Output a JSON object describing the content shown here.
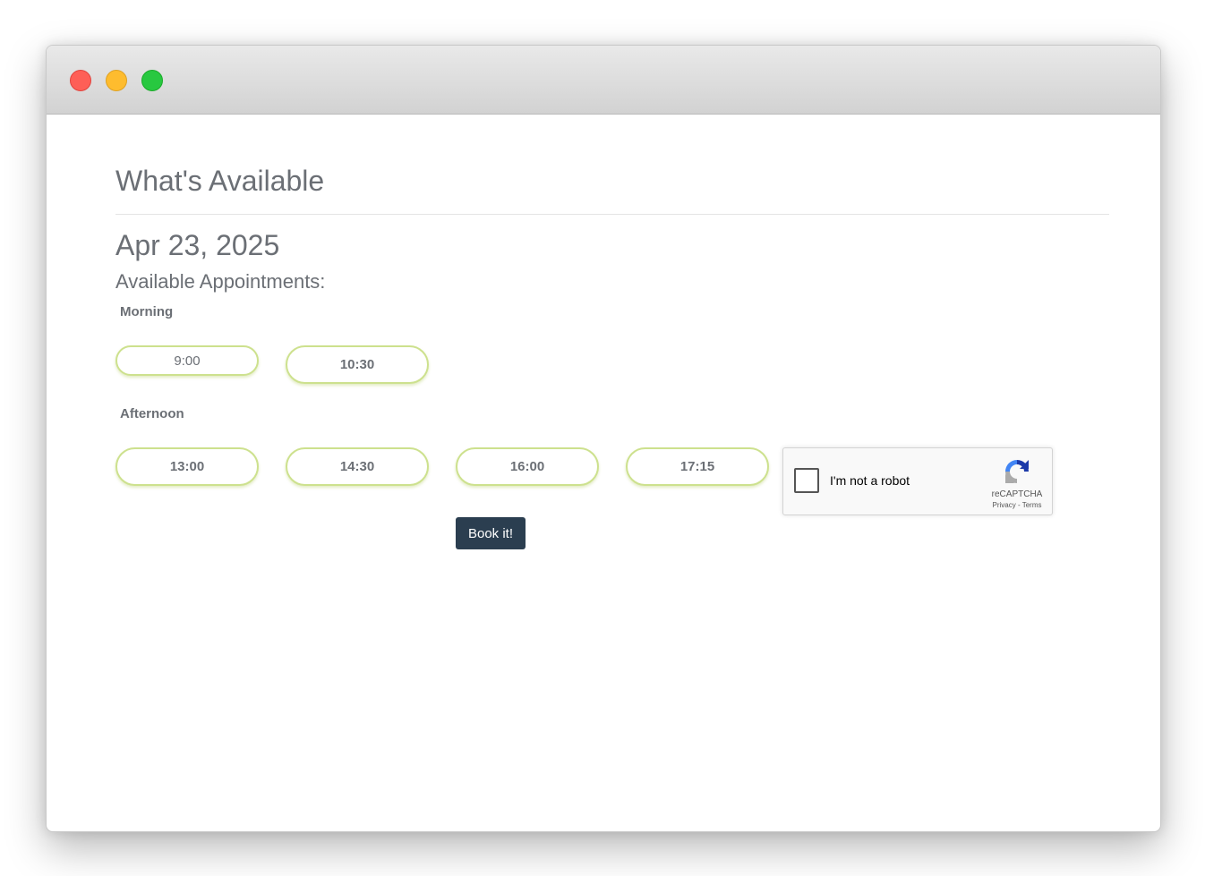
{
  "window": {
    "controls": [
      "close",
      "minimize",
      "maximize"
    ]
  },
  "page": {
    "title": "What's Available",
    "date": "Apr 23, 2025",
    "subheading": "Available Appointments:"
  },
  "morning": {
    "label": "Morning",
    "slots": [
      "9:00",
      "10:30"
    ]
  },
  "afternoon": {
    "label": "Afternoon",
    "slots": [
      "13:00",
      "14:30",
      "16:00",
      "17:15"
    ]
  },
  "recaptcha": {
    "label": "I'm not a robot",
    "brand": "reCAPTCHA",
    "privacy": "Privacy",
    "separator": "-",
    "terms": "Terms"
  },
  "actions": {
    "book_label": "Book it!"
  },
  "colors": {
    "slot_border": "#cde18e",
    "button_bg": "#2b3e50",
    "text": "#6b6f75"
  }
}
